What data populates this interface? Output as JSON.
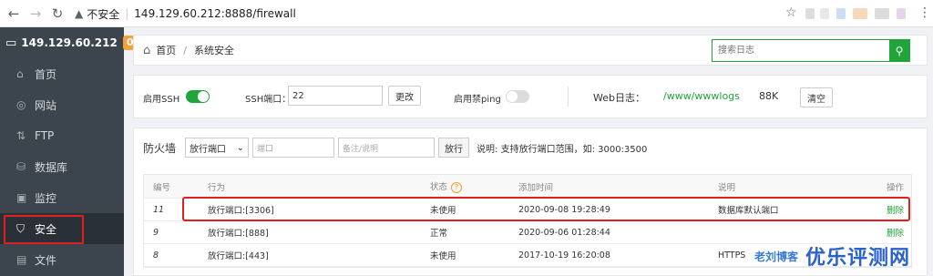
{
  "browser": {
    "security_label": "不安全",
    "url": "149.129.60.212:8888/firewall"
  },
  "sidebar": {
    "server_ip": "149.129.60.212",
    "badge_count": "0",
    "items": [
      {
        "label": "首页",
        "icon": "home-icon"
      },
      {
        "label": "网站",
        "icon": "globe-icon"
      },
      {
        "label": "FTP",
        "icon": "ftp-icon"
      },
      {
        "label": "数据库",
        "icon": "database-icon"
      },
      {
        "label": "监控",
        "icon": "monitor-icon"
      },
      {
        "label": "安全",
        "icon": "shield-icon",
        "active": true
      },
      {
        "label": "文件",
        "icon": "folder-icon"
      }
    ]
  },
  "breadcrumb": {
    "home": "首页",
    "current": "系统安全"
  },
  "search": {
    "placeholder": "搜索日志"
  },
  "settings": {
    "ssh_toggle_label": "启用SSH",
    "ssh_toggle_on": true,
    "ssh_port_label": "SSH端口：",
    "ssh_port_value": "22",
    "change_button": "更改",
    "ping_toggle_label": "启用禁ping",
    "ping_toggle_on": false,
    "weblog_label": "Web日志：",
    "weblog_path": "/www/wwwlogs",
    "weblog_size": "88K",
    "clear_button": "清空"
  },
  "firewall": {
    "title": "防火墙",
    "select_value": "放行端口",
    "port_placeholder": "端口",
    "note_placeholder": "备注/说明",
    "allow_button": "放行",
    "hint": "说明: 支持放行端口范围，如: 3000:3500",
    "columns": [
      "编号",
      "行为",
      "状态",
      "添加时间",
      "说明",
      "操作"
    ],
    "rows": [
      {
        "id": "11",
        "action": "放行端口:[3306]",
        "status": "未使用",
        "time": "2020-09-08 19:28:49",
        "note": "数据库默认端口",
        "op": "删除"
      },
      {
        "id": "9",
        "action": "放行端口:[888]",
        "status": "正常",
        "time": "2020-09-06 01:28:44",
        "note": "",
        "op": "删除"
      },
      {
        "id": "8",
        "action": "放行端口:[443]",
        "status": "未使用",
        "time": "2017-10-19 16:20:08",
        "note": "HTTPS",
        "op": ""
      }
    ]
  },
  "watermark": {
    "small": "老刘博客",
    "big": "优乐评测网"
  },
  "colors": {
    "accent": "#20a53a",
    "sidebar_bg": "#3c444d",
    "highlight": "#e02020"
  }
}
